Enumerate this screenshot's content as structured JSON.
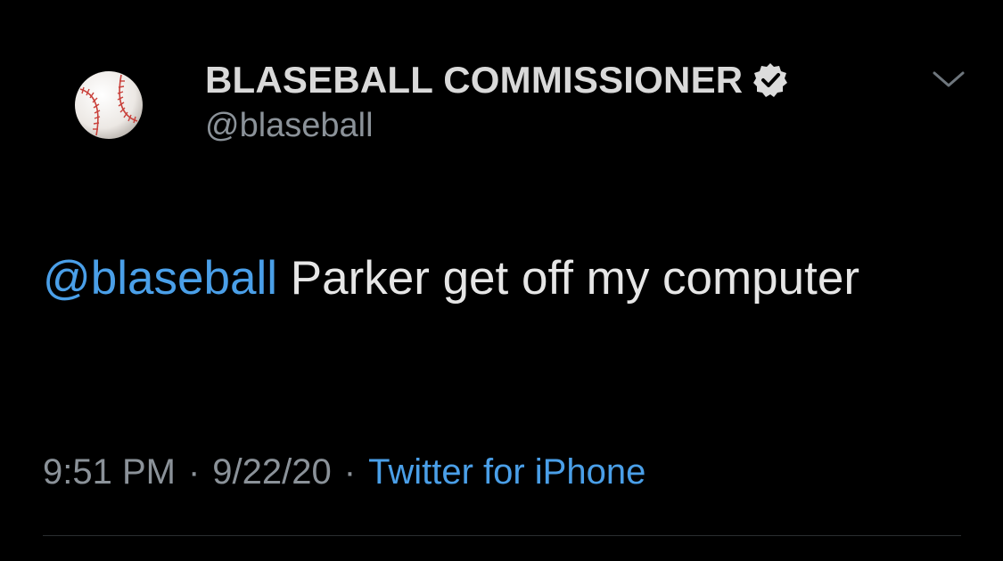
{
  "author": {
    "display_name": "BLASEBALL COMMISSIONER",
    "handle": "@blaseball",
    "avatar_icon": "baseball-icon",
    "verified": true
  },
  "tweet": {
    "mention": "@blaseball",
    "text": " Parker get off my computer"
  },
  "meta": {
    "time": "9:51 PM",
    "separator": "·",
    "date": "9/22/20",
    "source": "Twitter for iPhone"
  },
  "colors": {
    "background": "#000000",
    "link": "#4a9fe8",
    "primary_text": "#e6e6e6",
    "secondary_text": "#8b9299"
  },
  "icons": {
    "menu": "chevron-down-icon",
    "verified": "verified-badge-icon"
  }
}
